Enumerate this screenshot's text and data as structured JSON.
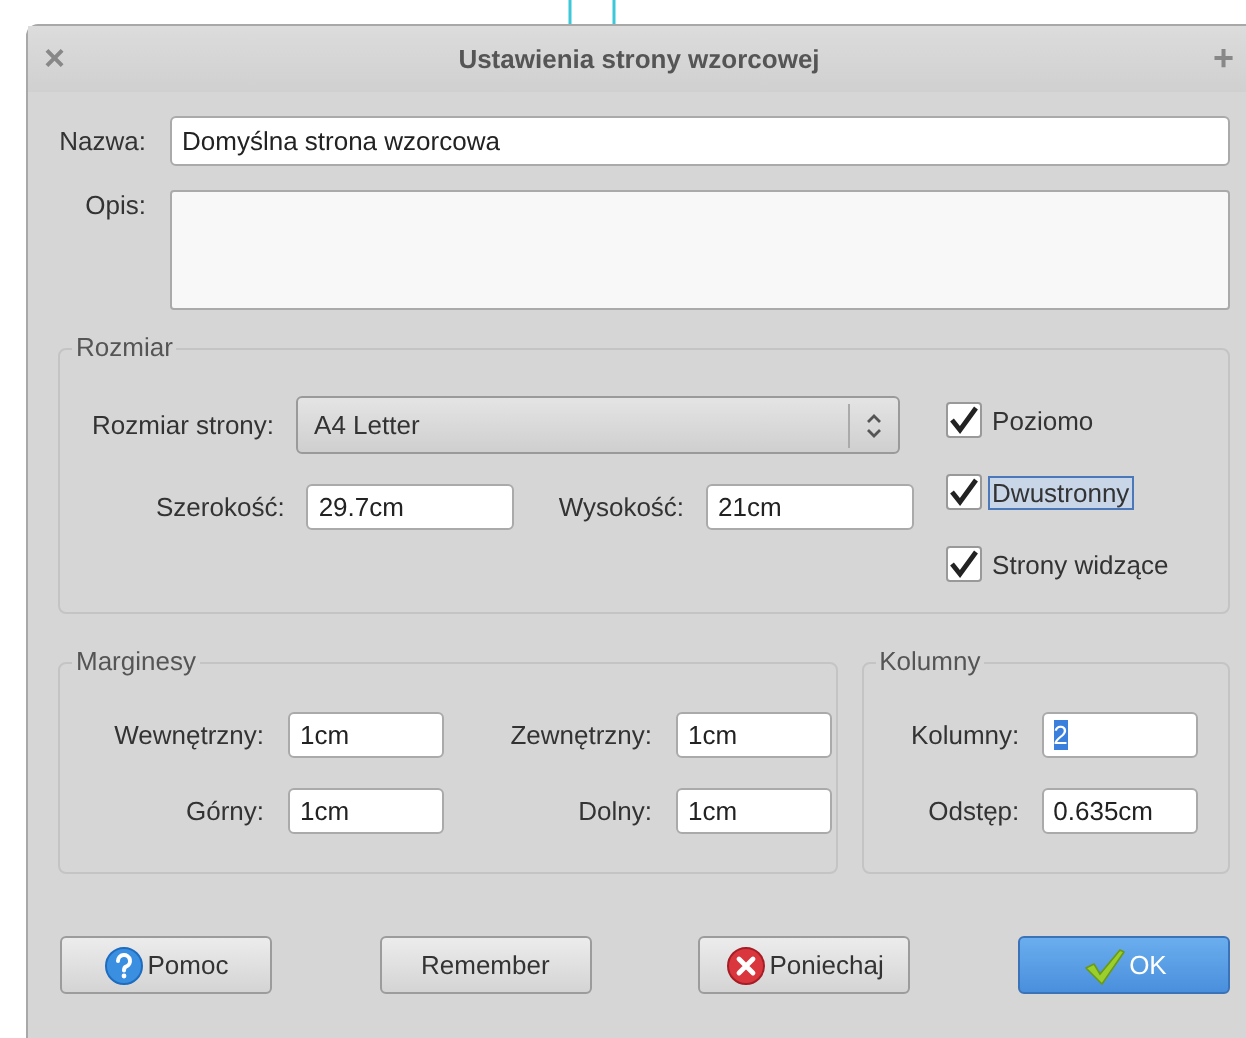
{
  "window": {
    "title": "Ustawienia strony wzorcowej",
    "close_glyph": "×",
    "maximize_glyph": "+"
  },
  "name_field": {
    "label": "Nazwa:",
    "value": "Domyślna strona wzorcowa"
  },
  "description_field": {
    "label": "Opis:"
  },
  "size_group": {
    "title": "Rozmiar",
    "page_size_label": "Rozmiar strony:",
    "page_size_value": "A4 Letter",
    "fields": [
      {
        "label": "Szerokość:",
        "value": "29.7cm",
        "highlighted": false
      },
      {
        "label": "Wysokość:",
        "value": "21cm",
        "highlighted": false
      }
    ],
    "checkboxes": [
      {
        "label": "Poziomo",
        "checked": true,
        "focused": false
      },
      {
        "label": "Dwustronny",
        "checked": true,
        "focused": true
      },
      {
        "label": "Strony widzące",
        "checked": true,
        "focused": false
      }
    ]
  },
  "margins_group": {
    "title": "Marginesy",
    "fields": [
      {
        "label": "Wewnętrzny:",
        "value": "1cm",
        "highlighted": false
      },
      {
        "label": "Zewnętrzny:",
        "value": "1cm",
        "highlighted": false
      },
      {
        "label": "Górny:",
        "value": "1cm",
        "highlighted": false
      },
      {
        "label": "Dolny:",
        "value": "1cm",
        "highlighted": false
      }
    ]
  },
  "columns_group": {
    "title": "Kolumny",
    "fields": [
      {
        "label": "Kolumny:",
        "value": "2",
        "highlighted": true
      },
      {
        "label": "Odstęp:",
        "value": "0.635cm",
        "highlighted": false
      }
    ]
  },
  "buttons": [
    {
      "label": "Pomoc",
      "kind": "help",
      "default": false
    },
    {
      "label": "Remember",
      "kind": "plain",
      "default": false
    },
    {
      "label": "Poniechaj",
      "kind": "cancel",
      "default": false
    },
    {
      "label": "OK",
      "kind": "ok",
      "default": true
    }
  ]
}
